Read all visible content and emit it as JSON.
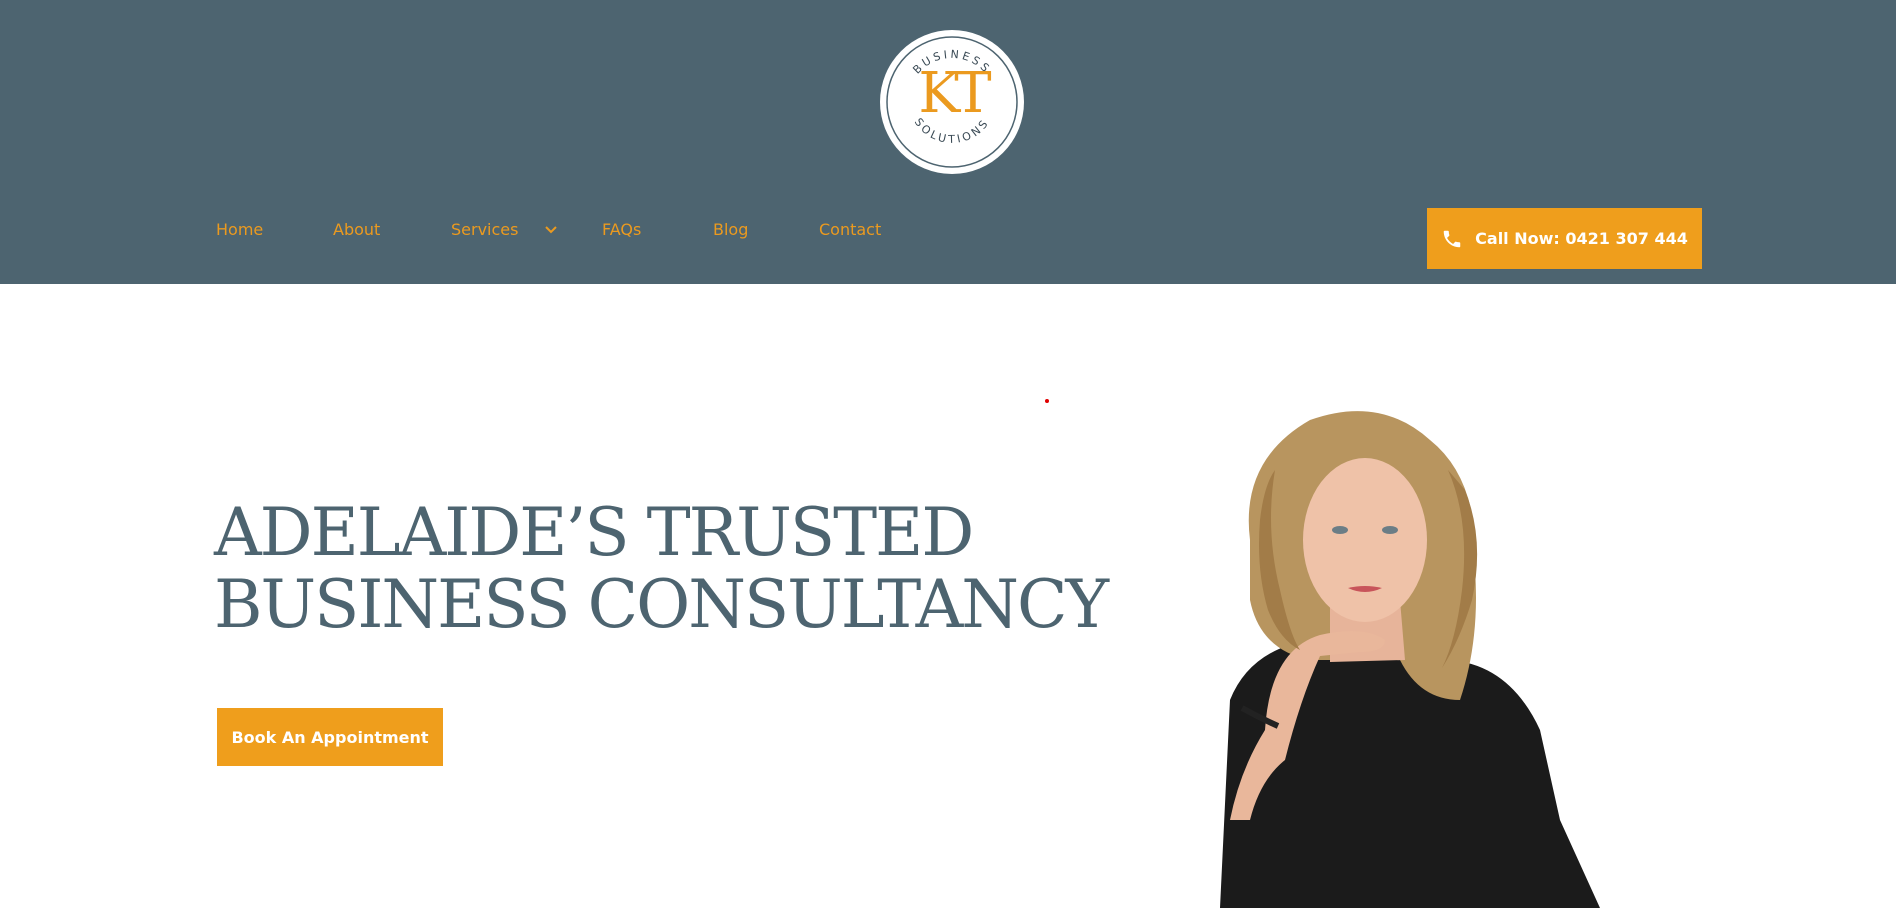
{
  "header": {
    "logo": {
      "top_text": "BUSINESS",
      "mark": "KT",
      "bottom_text": "SOLUTIONS"
    },
    "nav": [
      {
        "label": "Home"
      },
      {
        "label": "About"
      },
      {
        "label": "Services"
      },
      {
        "label": "FAQs"
      },
      {
        "label": "Blog"
      },
      {
        "label": "Contact"
      }
    ],
    "call_button": {
      "label": "Call Now: 0421 307 444",
      "icon": "phone-icon"
    }
  },
  "hero": {
    "title_line1": "ADELAIDE’S TRUSTED",
    "title_line2": "BUSINESS CONSULTANCY",
    "cta_label": "Book An Appointment"
  },
  "colors": {
    "header_bg": "#4d6470",
    "accent": "#ef9e1c",
    "title": "#4d6470"
  }
}
